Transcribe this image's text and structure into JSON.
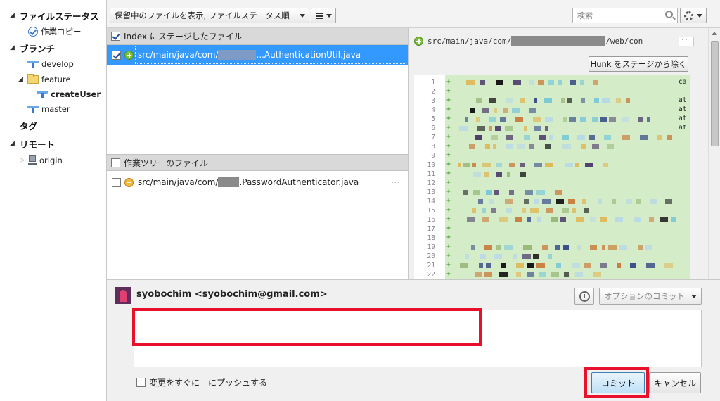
{
  "sidebar": {
    "file_status": "ファイルステータス",
    "working_copy": "作業コピー",
    "branches": "ブランチ",
    "branch_develop": "develop",
    "folder_feature": "feature",
    "branch_create_user": "createUser",
    "branch_master": "master",
    "tags": "タグ",
    "remotes": "リモート",
    "remote_origin": "origin"
  },
  "toolbar": {
    "view_select": "保留中のファイルを表示, ファイルステータス順",
    "search_placeholder": "検索"
  },
  "staged": {
    "header": "Index にステージしたファイル",
    "files": [
      {
        "prefix": "src/main/java/com/",
        "suffix": "...AuthenticationUtil.java",
        "status": "added",
        "checked": true
      }
    ]
  },
  "unstaged": {
    "header": "作業ツリーのファイル",
    "files": [
      {
        "prefix": "src/main/java/com/",
        "suffix": ".PasswordAuthenticator.java",
        "status": "modified",
        "checked": false,
        "more": "···"
      }
    ]
  },
  "diff": {
    "path_prefix": "src/main/java/com/",
    "path_suffix": "/web/con",
    "more": "···",
    "hunk_button": "Hunk をステージから除く",
    "line_numbers": [
      "1",
      "2",
      "3",
      "4",
      "5",
      "6",
      "7",
      "8",
      "9",
      "10",
      "11",
      "12",
      "13",
      "14",
      "15",
      "16",
      "17",
      "18",
      "19",
      "20",
      "21",
      "22"
    ],
    "trailing_text": [
      "ca",
      "at",
      "at",
      "at",
      "at"
    ]
  },
  "commit": {
    "author": "syobochim <syobochim@gmail.com>",
    "options_button": "オプションのコミット",
    "message": "",
    "push_label": "変更をすぐに - にプッシュする",
    "commit_button": "コミット",
    "cancel_button": "キャンセル"
  },
  "colors": {
    "selection": "#3399ff",
    "diff_added_bg": "#d5ecc8",
    "annotation_red": "#e8102a"
  }
}
